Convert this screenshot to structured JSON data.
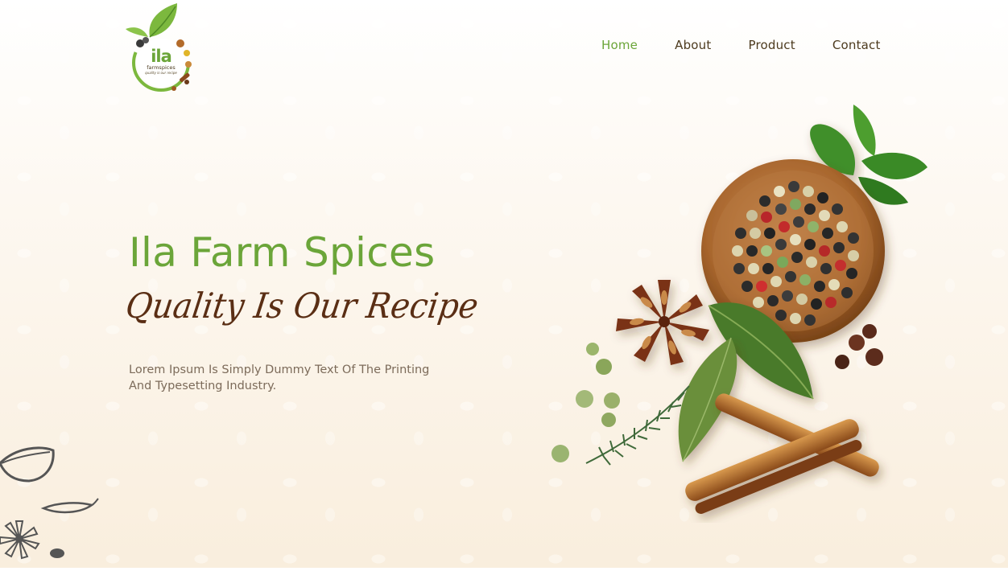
{
  "logo": {
    "brand": "ila",
    "sub": "farmspices",
    "tagline": "quality is our recipe"
  },
  "nav": {
    "items": [
      {
        "label": "Home",
        "active": true
      },
      {
        "label": "About",
        "active": false
      },
      {
        "label": "Product",
        "active": false
      },
      {
        "label": "Contact",
        "active": false
      }
    ]
  },
  "hero": {
    "title": "Ila Farm Spices",
    "subtitle": "Quality Is Our Recipe",
    "description": "Lorem Ipsum Is Simply Dummy Text Of The Printing And Typesetting Industry."
  },
  "theme": {
    "accent": "#6ba539",
    "brown": "#5a2e14",
    "text_muted": "#7c6b5a"
  }
}
